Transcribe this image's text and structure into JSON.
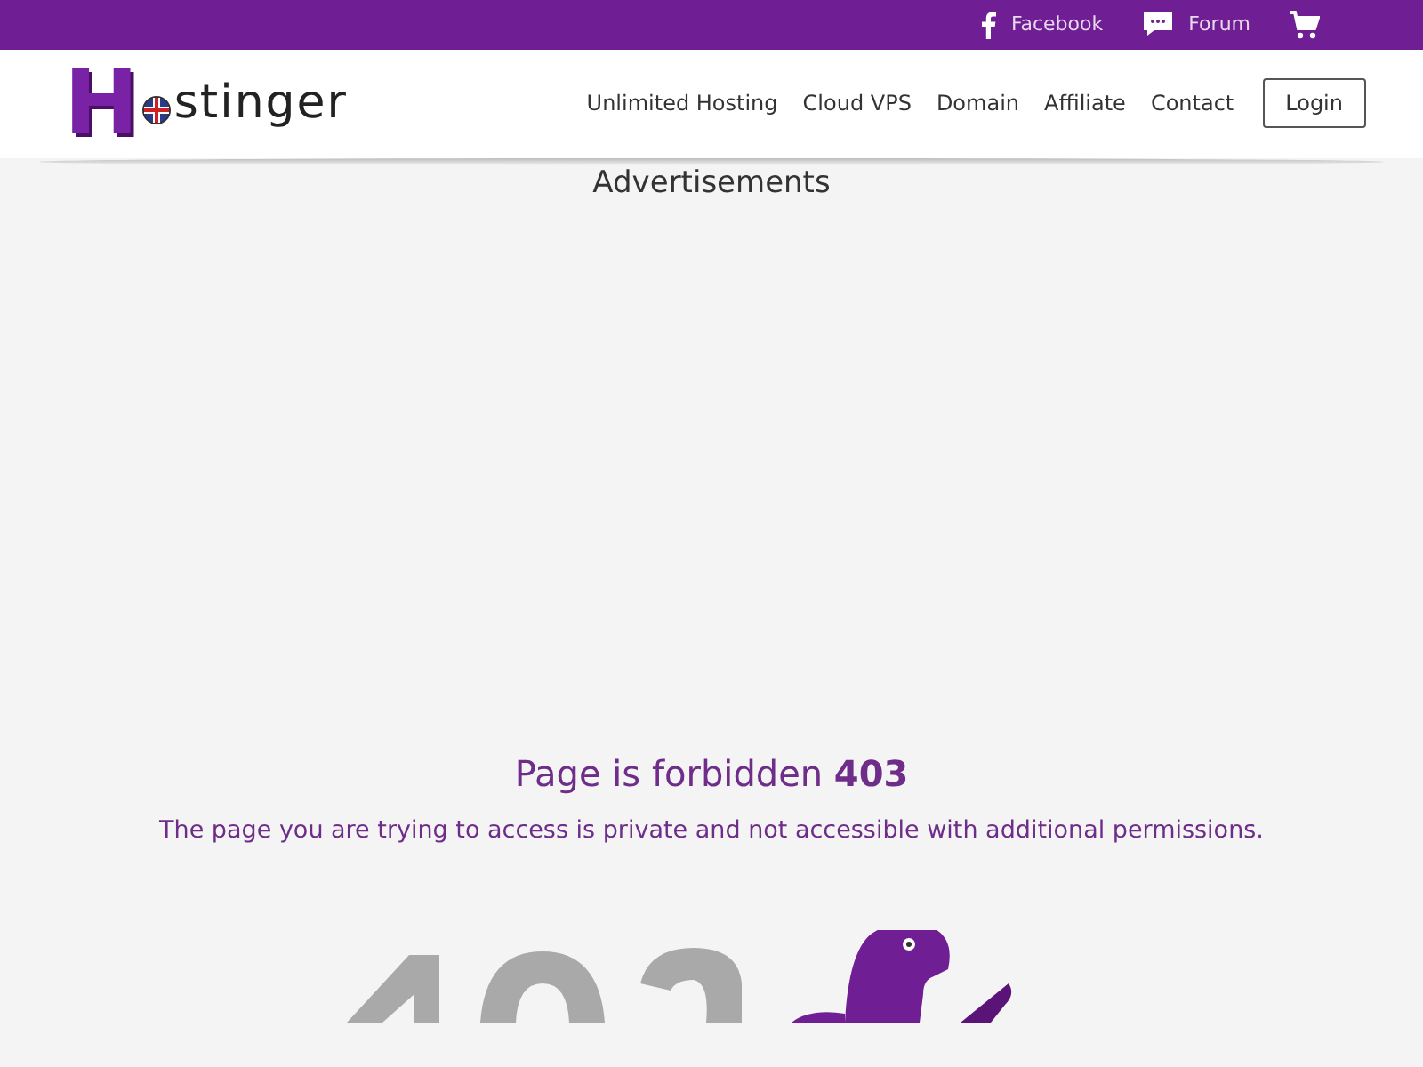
{
  "top_bar": {
    "links": [
      {
        "kind": "facebook",
        "label": "Facebook"
      },
      {
        "kind": "forum",
        "label": "Forum"
      },
      {
        "kind": "cart"
      }
    ]
  },
  "header": {
    "logo": {
      "initial": "H",
      "rest": "stinger"
    },
    "nav": [
      "Unlimited Hosting",
      "Cloud VPS",
      "Domain",
      "Affiliate",
      "Contact"
    ],
    "login": "Login"
  },
  "ads": {
    "title": "Advertisements"
  },
  "error": {
    "title": "Page is forbidden **403**",
    "message": "The page you are trying to access is private and not accessible with additional permissions."
  }
}
